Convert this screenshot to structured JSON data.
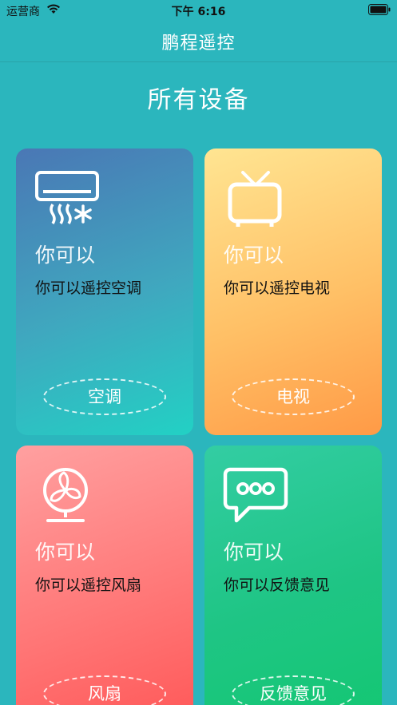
{
  "status_bar": {
    "carrier": "运营商",
    "time": "下午 6:16"
  },
  "nav": {
    "title": "鹏程遥控"
  },
  "section": {
    "title": "所有设备"
  },
  "cards": [
    {
      "icon": "air-conditioner-icon",
      "head": "你可以",
      "desc": "你可以遥控空调",
      "button": "空调"
    },
    {
      "icon": "tv-icon",
      "head": "你可以",
      "desc": "你可以遥控电视",
      "button": "电视"
    },
    {
      "icon": "fan-icon",
      "head": "你可以",
      "desc": "你可以遥控风扇",
      "button": "风扇"
    },
    {
      "icon": "chat-bubble-icon",
      "head": "你可以",
      "desc": "你可以反馈意见",
      "button": "反馈意见"
    }
  ]
}
